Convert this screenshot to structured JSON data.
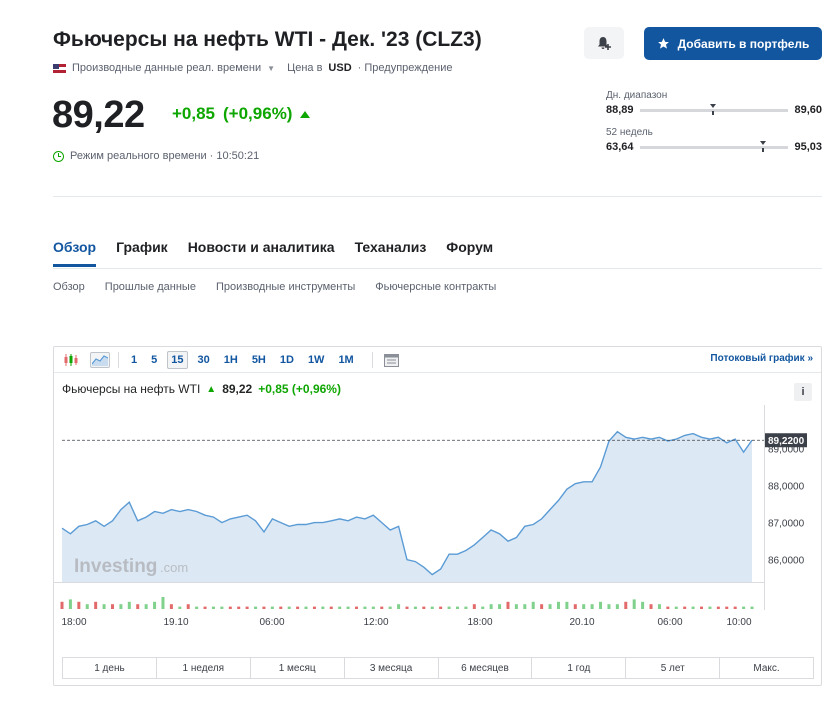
{
  "header": {
    "title": "Фьючерсы на нефть WTI - Дек. '23 (CLZ3)",
    "data_source": "Производные данные реал. времени",
    "currency_label": "Цена в",
    "currency": "USD",
    "warning": "· Предупреждение",
    "portfolio_button": "Добавить в портфель"
  },
  "quote": {
    "price": "89,22",
    "change": "+0,85",
    "change_pct": "(+0,96%)",
    "realtime": "Режим реального времени · 10:50:21"
  },
  "ranges": {
    "day": {
      "label": "Дн. диапазон",
      "low": "88,89",
      "high": "89,60",
      "position": 0.47
    },
    "week52": {
      "label": "52 недель",
      "low": "63,64",
      "high": "95,03",
      "position": 0.81
    }
  },
  "tabs": [
    "Обзор",
    "График",
    "Новости и аналитика",
    "Теханализ",
    "Форум"
  ],
  "subtabs": [
    "Обзор",
    "Прошлые данные",
    "Производные инструменты",
    "Фьючерсные контракты"
  ],
  "chart_widget": {
    "timeframes": [
      "1",
      "5",
      "15",
      "30",
      "1H",
      "5H",
      "1D",
      "1W",
      "1M"
    ],
    "selected_timeframe": "15",
    "stream_link": "Потоковый график »",
    "series_name": "Фьючерсы на нефть WTI",
    "price": "89,22",
    "change": "+0,85 (+0,96%)",
    "watermark": "Investing",
    "watermark_suffix": ".com",
    "periods": [
      "1 день",
      "1 неделя",
      "1 месяц",
      "3 месяца",
      "6 месяцев",
      "1 год",
      "5 лет",
      "Макс."
    ]
  },
  "chart_data": {
    "type": "area",
    "title": "",
    "xlabel": "",
    "ylabel": "",
    "x_tick_labels": [
      "18:00",
      "19.10",
      "06:00",
      "12:00",
      "18:00",
      "20.10",
      "06:00",
      "10:00"
    ],
    "y_tick_labels": [
      "86,0000",
      "87,0000",
      "88,0000",
      "89,0000"
    ],
    "ylim": [
      85.4,
      89.9
    ],
    "last_value_label": "89,2200",
    "last_value": 89.22,
    "colors": {
      "line": "#5b9bd5",
      "fill": "#dce9f5",
      "vol_up": "#7fd18b",
      "vol_down": "#e36a6a"
    },
    "series": [
      {
        "name": "Фьючерсы на нефть WTI",
        "values": [
          86.85,
          86.7,
          86.9,
          86.95,
          87.05,
          86.9,
          87.05,
          87.35,
          87.55,
          87.05,
          87.15,
          87.3,
          87.25,
          87.35,
          87.3,
          87.35,
          87.3,
          87.2,
          87.15,
          87.0,
          87.1,
          87.15,
          87.2,
          87.05,
          86.75,
          87.1,
          87.0,
          86.9,
          86.95,
          86.95,
          87.0,
          87.0,
          87.05,
          87.1,
          87.05,
          87.15,
          87.1,
          87.2,
          87.0,
          86.8,
          86.9,
          86.0,
          85.95,
          85.8,
          85.6,
          85.75,
          86.15,
          86.15,
          86.25,
          86.4,
          86.6,
          86.8,
          86.7,
          86.5,
          86.6,
          86.9,
          86.95,
          87.1,
          87.35,
          87.6,
          87.9,
          88.05,
          88.1,
          88.1,
          88.5,
          89.2,
          89.45,
          89.3,
          89.25,
          89.3,
          89.25,
          89.3,
          89.2,
          89.25,
          89.35,
          89.4,
          89.3,
          89.25,
          89.3,
          89.15,
          89.25,
          88.9,
          89.22
        ]
      }
    ],
    "volume": [
      3,
      4,
      3,
      2,
      3,
      2,
      2,
      2,
      3,
      2,
      2,
      3,
      5,
      2,
      1,
      2,
      1,
      1,
      1,
      1,
      1,
      1,
      1,
      1,
      1,
      1,
      1,
      1,
      1,
      1,
      1,
      1,
      1,
      1,
      1,
      1,
      1,
      1,
      1,
      1,
      2,
      1,
      1,
      1,
      1,
      1,
      1,
      1,
      1,
      2,
      1,
      2,
      2,
      3,
      2,
      2,
      3,
      2,
      2,
      3,
      3,
      2,
      2,
      2,
      3,
      2,
      2,
      3,
      4,
      3,
      2,
      2,
      1,
      1,
      1,
      1,
      1,
      1,
      1,
      1,
      1,
      1,
      1
    ],
    "volume_up": [
      0,
      1,
      0,
      1,
      0,
      1,
      0,
      1,
      1,
      0,
      1,
      1,
      1,
      0,
      1,
      0,
      1,
      0,
      1,
      1,
      0,
      0,
      0,
      1,
      0,
      1,
      0,
      1,
      0,
      1,
      0,
      1,
      0,
      1,
      1,
      0,
      1,
      1,
      0,
      1,
      1,
      0,
      1,
      0,
      1,
      0,
      1,
      1,
      1,
      0,
      1,
      1,
      1,
      0,
      1,
      1,
      1,
      0,
      1,
      1,
      1,
      0,
      1,
      1,
      1,
      1,
      1,
      0,
      1,
      1,
      0,
      1,
      0,
      1,
      0,
      1,
      0,
      1,
      0,
      0,
      0,
      1,
      1
    ]
  }
}
